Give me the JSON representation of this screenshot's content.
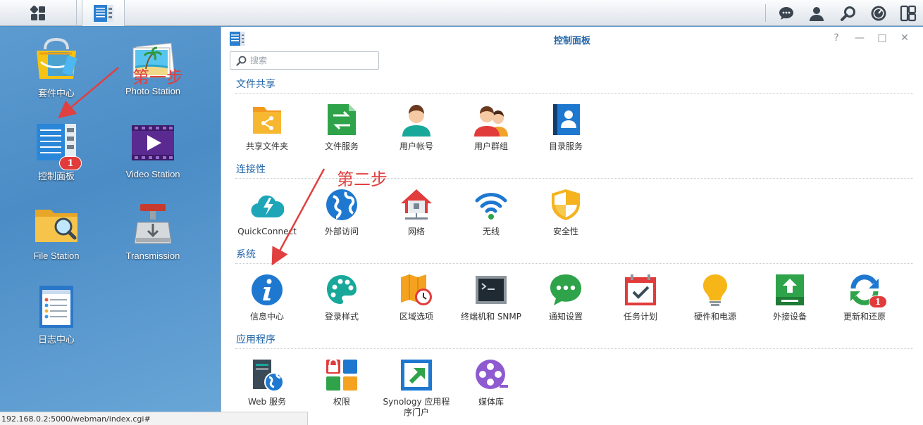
{
  "taskbar": {
    "main_menu_icon": "grid-icon",
    "running_app_icon": "control-panel-icon",
    "right_icons": [
      "chat-icon",
      "user-icon",
      "search-icon",
      "dashboard-icon",
      "widgets-icon"
    ]
  },
  "desktop": {
    "icons": [
      {
        "label": "套件中心",
        "icon": "package-center-icon"
      },
      {
        "label": "Photo Station",
        "icon": "photo-station-icon"
      },
      {
        "label": "控制面板",
        "icon": "control-panel-icon",
        "badge": "1"
      },
      {
        "label": "Video Station",
        "icon": "video-station-icon"
      },
      {
        "label": "File Station",
        "icon": "file-station-icon"
      },
      {
        "label": "Transmission",
        "icon": "transmission-icon"
      },
      {
        "label": "日志中心",
        "icon": "log-center-icon"
      }
    ]
  },
  "annotations": {
    "step1": "第一步",
    "step2": "第二步"
  },
  "window": {
    "title": "控制面板",
    "controls": [
      "?",
      "—",
      "□",
      "✕"
    ],
    "search_placeholder": "搜索"
  },
  "sections": [
    {
      "title": "文件共享",
      "items": [
        {
          "label": "共享文件夹",
          "icon": "shared-folder-icon"
        },
        {
          "label": "文件服务",
          "icon": "file-services-icon"
        },
        {
          "label": "用户帐号",
          "icon": "user-icon"
        },
        {
          "label": "用户群组",
          "icon": "group-icon"
        },
        {
          "label": "目录服务",
          "icon": "directory-service-icon"
        }
      ]
    },
    {
      "title": "连接性",
      "items": [
        {
          "label": "QuickConnect",
          "icon": "quickconnect-icon"
        },
        {
          "label": "外部访问",
          "icon": "external-access-icon"
        },
        {
          "label": "网络",
          "icon": "network-icon"
        },
        {
          "label": "无线",
          "icon": "wireless-icon"
        },
        {
          "label": "安全性",
          "icon": "security-icon"
        }
      ]
    },
    {
      "title": "系统",
      "items": [
        {
          "label": "信息中心",
          "icon": "info-center-icon"
        },
        {
          "label": "登录样式",
          "icon": "theme-icon"
        },
        {
          "label": "区域选项",
          "icon": "regional-options-icon"
        },
        {
          "label": "终端机和 SNMP",
          "icon": "terminal-icon"
        },
        {
          "label": "通知设置",
          "icon": "notification-icon"
        },
        {
          "label": "任务计划",
          "icon": "task-scheduler-icon"
        },
        {
          "label": "硬件和电源",
          "icon": "hardware-power-icon"
        },
        {
          "label": "外接设备",
          "icon": "external-devices-icon"
        },
        {
          "label": "更新和还原",
          "icon": "update-restore-icon",
          "badge": "1"
        }
      ]
    },
    {
      "title": "应用程序",
      "items": [
        {
          "label": "Web 服务",
          "icon": "web-services-icon"
        },
        {
          "label": "权限",
          "icon": "privileges-icon"
        },
        {
          "label": "Synology 应用程序门户",
          "icon": "application-portal-icon"
        },
        {
          "label": "媒体库",
          "icon": "media-library-icon"
        }
      ]
    }
  ],
  "statusbar": {
    "url": "192.168.0.2:5000/webman/index.cgi#"
  }
}
